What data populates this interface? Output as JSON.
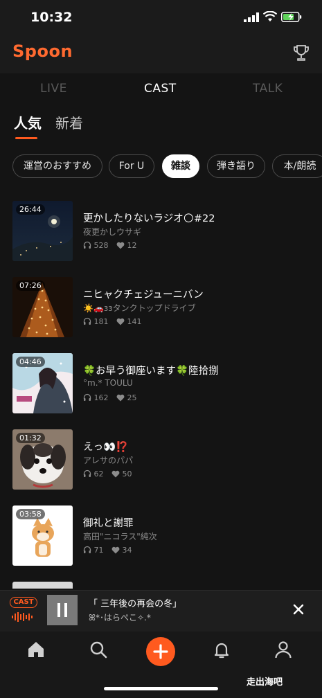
{
  "status": {
    "time": "10:32"
  },
  "header": {
    "logo": "Spoon"
  },
  "tabs": [
    {
      "label": "LIVE",
      "active": false
    },
    {
      "label": "CAST",
      "active": true
    },
    {
      "label": "TALK",
      "active": false
    }
  ],
  "subtabs": [
    {
      "label": "人気",
      "active": true
    },
    {
      "label": "新着",
      "active": false
    }
  ],
  "chips": [
    {
      "label": "運営のおすすめ",
      "active": false
    },
    {
      "label": "For U",
      "active": false
    },
    {
      "label": "雑談",
      "active": true
    },
    {
      "label": "弾き語り",
      "active": false
    },
    {
      "label": "本/朗読",
      "active": false
    }
  ],
  "casts": [
    {
      "duration": "26:44",
      "title": "更かしたりないラジオ🌕#22",
      "author": "夜更かしウサギ",
      "plays": "528",
      "likes": "12"
    },
    {
      "duration": "07:26",
      "title": "ニヒャクチェジューニバン",
      "author": "☀️🚗ззタンクトップドライブ",
      "plays": "181",
      "likes": "141"
    },
    {
      "duration": "04:46",
      "title": "🍀お早う御座います🍀陸拾捌",
      "author": "°m.* TOULU",
      "plays": "162",
      "likes": "25"
    },
    {
      "duration": "01:32",
      "title": "えっ👀⁉️",
      "author": "アレサのパパ",
      "plays": "62",
      "likes": "50"
    },
    {
      "duration": "03:58",
      "title": "御礼と謝罪",
      "author": "高田\"ニコラス\"純次",
      "plays": "71",
      "likes": "34"
    }
  ],
  "player": {
    "badge": "CAST",
    "title": "「 三年後の再会の冬」",
    "author": "ꕤ*･はらぺこ✧.*"
  },
  "watermark": "走出海吧",
  "colors": {
    "accent": "#ff5a1f",
    "background": "#141414"
  }
}
